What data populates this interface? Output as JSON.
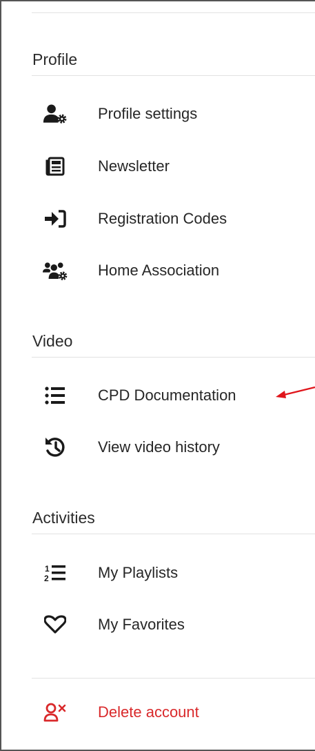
{
  "sections": {
    "profile": {
      "title": "Profile",
      "items": [
        {
          "label": "Profile settings",
          "icon": "user-gear-icon"
        },
        {
          "label": "Newsletter",
          "icon": "newspaper-icon"
        },
        {
          "label": "Registration Codes",
          "icon": "sign-in-icon"
        },
        {
          "label": "Home Association",
          "icon": "users-gear-icon"
        }
      ]
    },
    "video": {
      "title": "Video",
      "items": [
        {
          "label": "CPD Documentation",
          "icon": "list-icon"
        },
        {
          "label": "View video history",
          "icon": "history-icon"
        }
      ]
    },
    "activities": {
      "title": "Activities",
      "items": [
        {
          "label": "My Playlists",
          "icon": "ordered-list-icon"
        },
        {
          "label": "My Favorites",
          "icon": "heart-outline-icon"
        }
      ]
    }
  },
  "account": {
    "delete_label": "Delete account",
    "icon": "user-delete-icon"
  },
  "colors": {
    "text": "#262626",
    "icon": "#1a1a1a",
    "danger": "#d9292b",
    "divider": "#e2e2e2",
    "annotation_arrow": "#e0151b"
  },
  "annotation": {
    "target": "CPD Documentation",
    "type": "arrow"
  }
}
